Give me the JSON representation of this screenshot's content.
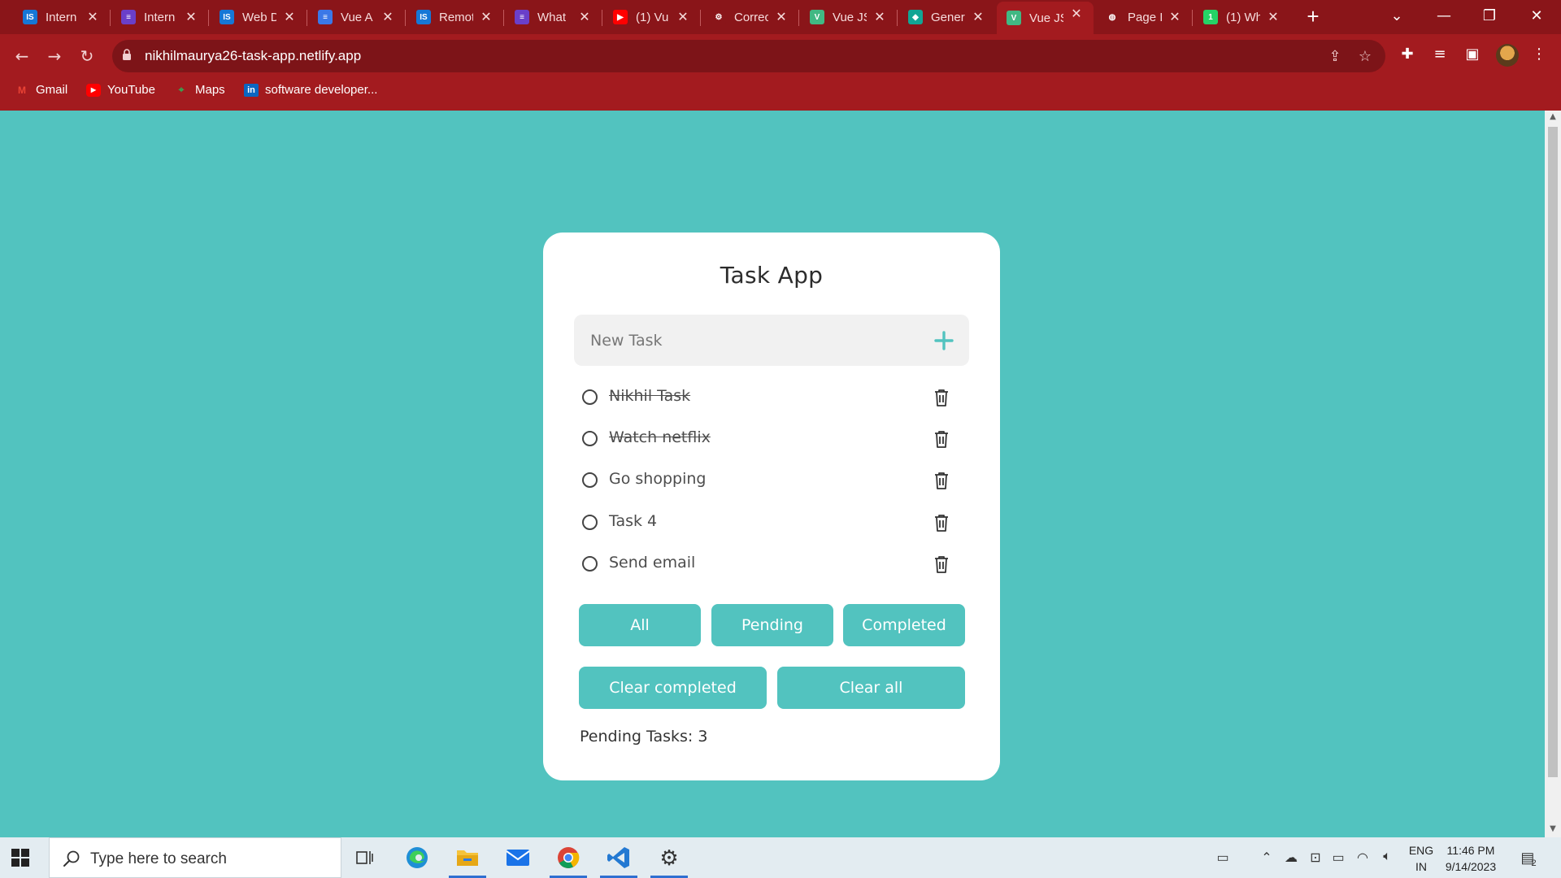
{
  "browser": {
    "tabs": [
      {
        "title": "Intern",
        "favicon": "internshala-icon",
        "color": "#1677d6",
        "glyph": "IS"
      },
      {
        "title": "Intern",
        "favicon": "forms-icon",
        "color": "#6a3fc9",
        "glyph": "≡"
      },
      {
        "title": "Web D",
        "favicon": "internshala-icon",
        "color": "#1677d6",
        "glyph": "IS"
      },
      {
        "title": "Vue A",
        "favicon": "docs-icon",
        "color": "#3b78e7",
        "glyph": "≡"
      },
      {
        "title": "Remot",
        "favicon": "internshala-icon",
        "color": "#1677d6",
        "glyph": "IS"
      },
      {
        "title": "What",
        "favicon": "forms-icon",
        "color": "#6a3fc9",
        "glyph": "≡"
      },
      {
        "title": "(1) Vu",
        "favicon": "youtube-icon",
        "color": "#ff0000",
        "glyph": "▶"
      },
      {
        "title": "Correc",
        "favicon": "openai-icon",
        "color": "#8a1519",
        "glyph": "⚙"
      },
      {
        "title": "Vue JS",
        "favicon": "vue-icon",
        "color": "#41b883",
        "glyph": "V"
      },
      {
        "title": "Gener",
        "favicon": "diamond-icon",
        "color": "#12a594",
        "glyph": "◆"
      },
      {
        "title": "Vue JS",
        "favicon": "vue-icon",
        "color": "#41b883",
        "glyph": "V"
      },
      {
        "title": "Page I",
        "favicon": "globe-icon",
        "color": "#8a1519",
        "glyph": "◍"
      },
      {
        "title": "(1) Wh",
        "favicon": "whatsapp-icon",
        "color": "#25d366",
        "glyph": "1"
      }
    ],
    "active_tab_index": 10,
    "url": "nikhilmaurya26-task-app.netlify.app",
    "bookmarks": [
      {
        "label": "Gmail",
        "icon": "gmail-icon"
      },
      {
        "label": "YouTube",
        "icon": "youtube-icon"
      },
      {
        "label": "Maps",
        "icon": "maps-icon"
      },
      {
        "label": "software developer...",
        "icon": "linkedin-icon"
      }
    ]
  },
  "app": {
    "title": "Task App",
    "input_placeholder": "New Task",
    "input_value": "",
    "tasks": [
      {
        "label": "Nikhil Task",
        "completed": true
      },
      {
        "label": "Watch netflix",
        "completed": true
      },
      {
        "label": "Go shopping",
        "completed": false
      },
      {
        "label": "Task 4",
        "completed": false
      },
      {
        "label": "Send email",
        "completed": false
      }
    ],
    "filters": {
      "all": "All",
      "pending": "Pending",
      "completed": "Completed"
    },
    "actions": {
      "clear_completed": "Clear completed",
      "clear_all": "Clear all"
    },
    "pending_text": "Pending Tasks: 3",
    "accent_color": "#52c3bf"
  },
  "taskbar": {
    "search_placeholder": "Type here to search",
    "language": "ENG",
    "region": "IN",
    "time": "11:46 PM",
    "date": "9/14/2023",
    "notification_count": "2"
  }
}
